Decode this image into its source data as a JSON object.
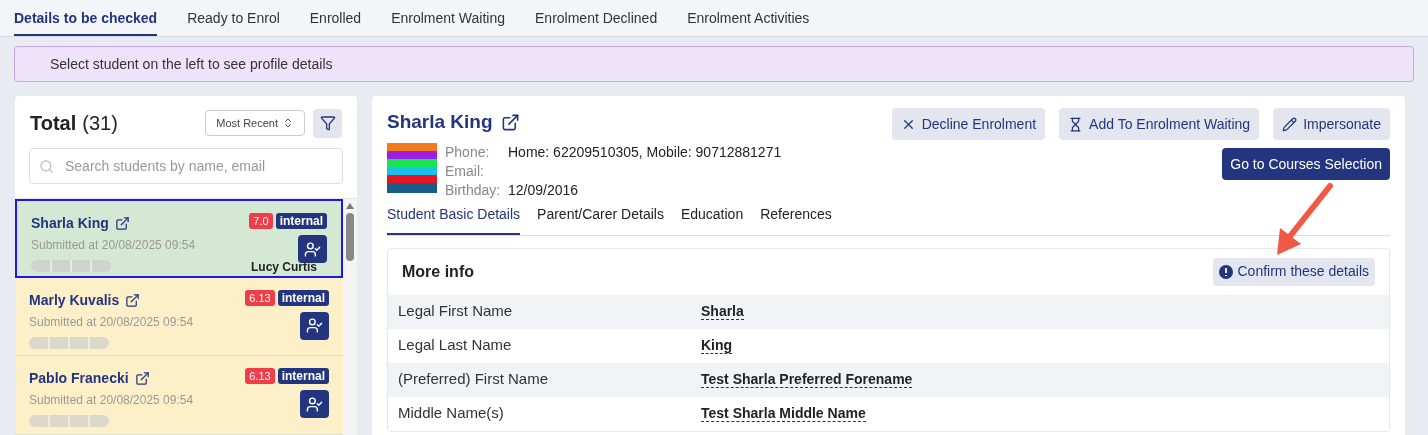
{
  "tabs": [
    {
      "label": "Details to be checked",
      "selected": true
    },
    {
      "label": "Ready to Enrol",
      "selected": false
    },
    {
      "label": "Enrolled",
      "selected": false
    },
    {
      "label": "Enrolment Waiting",
      "selected": false
    },
    {
      "label": "Enrolment Declined",
      "selected": false
    },
    {
      "label": "Enrolment Activities",
      "selected": false
    }
  ],
  "banner": "Select student on the left to see profile details",
  "list": {
    "title": "Total",
    "count": "(31)",
    "sort": "Most Recent",
    "search": {
      "placeholder": "Search students by name, email"
    },
    "students": [
      {
        "name": "Sharla King",
        "submitted": "Submitted at 20/08/2025 09:54",
        "score": "7.0",
        "tag": "internal",
        "assignee": "Lucy Curtis",
        "selected": true
      },
      {
        "name": "Marly Kuvalis",
        "submitted": "Submitted at 20/08/2025 09:54",
        "score": "6.13",
        "tag": "internal",
        "selected": false
      },
      {
        "name": "Pablo Franecki",
        "submitted": "Submitted at 20/08/2025 09:54",
        "score": "6.13",
        "tag": "internal",
        "selected": false
      }
    ]
  },
  "profile": {
    "name": "Sharla King",
    "fields": [
      {
        "label": "Phone:",
        "value": "Home: 62209510305, Mobile: 90712881271"
      },
      {
        "label": "Email:"
      },
      {
        "label": "Birthday:",
        "value": "12/09/2016"
      }
    ],
    "actions": [
      {
        "kind": "decline",
        "label": "Decline Enrolment"
      },
      {
        "kind": "wait",
        "label": "Add To Enrolment Waiting"
      },
      {
        "kind": "edit",
        "label": "Impersonate"
      }
    ],
    "primary_action": "Go to Courses Selection",
    "tabs": [
      {
        "label": "Student Basic Details",
        "selected": true
      },
      {
        "label": "Parent/Carer Details",
        "selected": false
      },
      {
        "label": "Education",
        "selected": false
      },
      {
        "label": "References",
        "selected": false
      }
    ],
    "section": {
      "title": "More info",
      "confirm": "Confirm these details",
      "rows": [
        {
          "label": "Legal First Name",
          "value": "Sharla"
        },
        {
          "label": "Legal Last Name",
          "value": "King"
        },
        {
          "label": "(Preferred) First Name",
          "value": "Test Sharla Preferred Forename"
        },
        {
          "label": "Middle Name(s)",
          "value": "Test Sharla Middle Name"
        }
      ]
    }
  }
}
